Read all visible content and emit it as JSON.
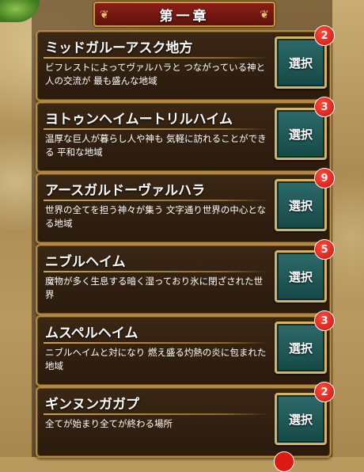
{
  "header": {
    "chapter_title": "第一章"
  },
  "select_label": "選択",
  "regions": [
    {
      "title": "ミッドガルーアスク地方",
      "description": "ビフレストによってヴァルハラと つながっている神と人の交流が 最も盛んな地域",
      "badge": "2"
    },
    {
      "title": "ヨトゥンヘイムートリルハイム",
      "description": "温厚な巨人が暮らし人や神も 気軽に訪れることができる 平和な地域",
      "badge": "3"
    },
    {
      "title": "アースガルドーヴァルハラ",
      "description": "世界の全てを担う神々が集う 文字通り世界の中心となる地域",
      "badge": "9"
    },
    {
      "title": "ニブルヘイム",
      "description": "魔物が多く生息する暗く湿っており氷に閉ざされた世界",
      "badge": "5"
    },
    {
      "title": "ムスペルヘイム",
      "description": "ニブルヘイムと対になり 燃え盛る灼熱の炎に包まれた地域",
      "badge": "3"
    },
    {
      "title": "ギンヌンガガプ",
      "description": "全てが始まり全てが終わる場所",
      "badge": "2"
    }
  ],
  "colors": {
    "banner": "#8b1f17",
    "button": "#2c6b6a",
    "badge": "#dd1a12",
    "border": "#b38a42"
  }
}
